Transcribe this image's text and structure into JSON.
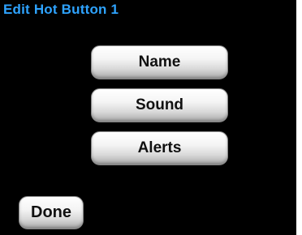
{
  "header": {
    "title": "Edit Hot Button 1"
  },
  "menu": {
    "items": [
      {
        "label": "Name"
      },
      {
        "label": "Sound"
      },
      {
        "label": "Alerts"
      }
    ]
  },
  "footer": {
    "done_label": "Done"
  },
  "colors": {
    "background": "#000000",
    "title": "#2ea3ff",
    "button_text": "#111111"
  }
}
